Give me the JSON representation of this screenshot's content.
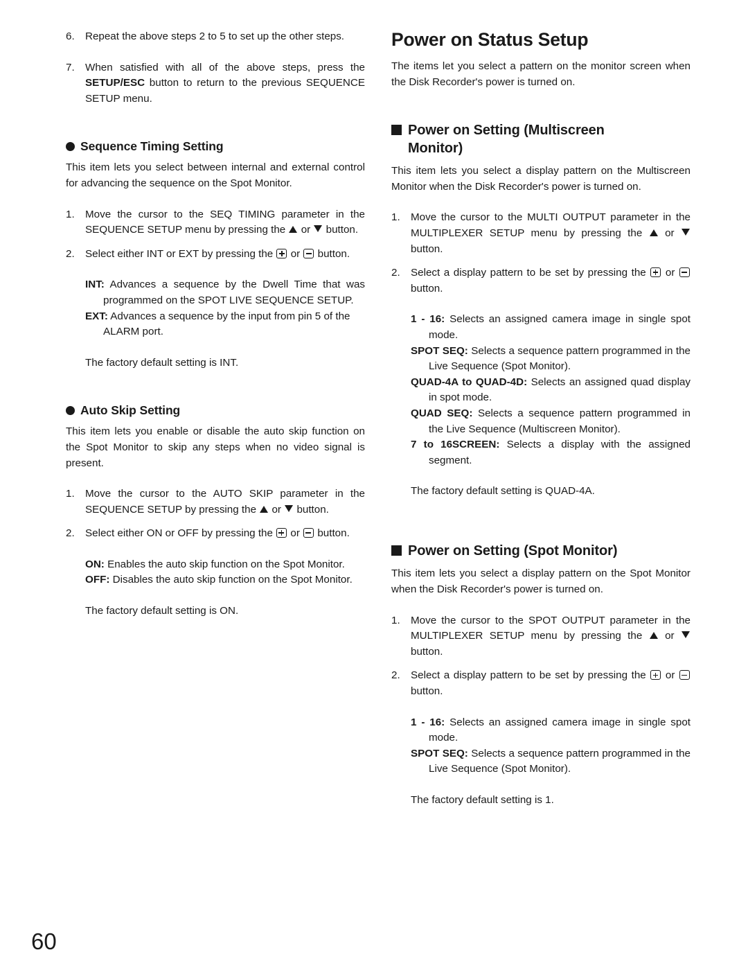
{
  "page": {
    "number": "60"
  },
  "left_column": {
    "step6": {
      "num": "6.",
      "text": "Repeat the above steps 2 to 5 to set up the other steps."
    },
    "step7": {
      "num": "7.",
      "text_before": "When satisfied with all of the above steps, press the ",
      "bold": "SETUP/ESC",
      "text_after": " button to return to the previous SEQUENCE SETUP menu."
    },
    "sequence_timing": {
      "heading": "Sequence Timing Setting",
      "intro": "This item lets you select between internal and external control for advancing the sequence on the Spot Monitor.",
      "step1": {
        "num": "1.",
        "text_a": "Move the cursor to the SEQ TIMING parameter in the SEQUENCE SETUP menu by pressing the ",
        "text_b": " or ",
        "text_c": " button."
      },
      "step2": {
        "num": "2.",
        "text_a": "Select either INT or EXT by pressing the ",
        "text_b": " or ",
        "text_c": " button."
      },
      "definitions": [
        {
          "term": "INT:",
          "text": " Advances a sequence by the Dwell Time that was programmed on the SPOT LIVE SEQUENCE SETUP."
        },
        {
          "term": "EXT:",
          "text": " Advances a sequence by the input from pin 5 of the ALARM port."
        }
      ],
      "default_note": "The factory default setting is INT."
    },
    "auto_skip": {
      "heading": "Auto Skip Setting",
      "intro": "This item lets you enable or disable the auto skip function on the Spot Monitor to skip any steps when no video signal is present.",
      "step1": {
        "num": "1.",
        "text_a": "Move the cursor to the AUTO SKIP parameter in the SEQUENCE SETUP by pressing the ",
        "text_b": " or ",
        "text_c": " button."
      },
      "step2": {
        "num": "2.",
        "text_a": "Select either ON or OFF by pressing the ",
        "text_b": " or ",
        "text_c": " button."
      },
      "definitions": [
        {
          "term": "ON:",
          "text": " Enables the auto skip function on the Spot Monitor."
        },
        {
          "term": "OFF:",
          "text": " Disables the auto skip function on the Spot Monitor."
        }
      ],
      "default_note": "The factory default setting is ON."
    }
  },
  "right_column": {
    "main_title": "Power on Status Setup",
    "main_intro": "The items let you select a pattern on the monitor screen when the Disk Recorder's power is turned on.",
    "multiscreen": {
      "heading_line1": "Power on Setting (Multiscreen",
      "heading_line2": "Monitor)",
      "intro": "This item lets you select a display pattern on the Multiscreen Monitor when the Disk Recorder's power is turned on.",
      "step1": {
        "num": "1.",
        "text_a": "Move the cursor to the MULTI OUTPUT parameter in the MULTIPLEXER SETUP menu by pressing the ",
        "text_b": " or ",
        "text_c": " button."
      },
      "step2": {
        "num": "2.",
        "text_a": "Select a display pattern to be set by pressing the ",
        "text_b": " or ",
        "text_c": " button."
      },
      "definitions": [
        {
          "term": "1 - 16:",
          "text": " Selects an assigned camera image in single spot mode."
        },
        {
          "term": "SPOT SEQ:",
          "text": " Selects a sequence pattern programmed in the Live Sequence (Spot Monitor)."
        },
        {
          "term": "QUAD-4A to QUAD-4D:",
          "text": " Selects an assigned quad display in spot mode."
        },
        {
          "term": "QUAD SEQ:",
          "text": " Selects a sequence pattern programmed in the Live Sequence (Multiscreen Monitor)."
        },
        {
          "term": "7 to 16SCREEN:",
          "text": " Selects a display with the assigned segment."
        }
      ],
      "default_note": "The factory default setting is QUAD-4A."
    },
    "spot": {
      "heading": "Power on Setting (Spot Monitor)",
      "intro": "This item lets you select a display pattern on the Spot Monitor when the Disk Recorder's power is turned on.",
      "step1": {
        "num": "1.",
        "text_a": "Move the cursor to the SPOT OUTPUT parameter in the MULTIPLEXER SETUP menu by pressing the ",
        "text_b": " or ",
        "text_c": " button."
      },
      "step2": {
        "num": "2.",
        "text_a": "Select a display pattern to be set by pressing the ",
        "text_b": " or ",
        "text_c": " button."
      },
      "definitions": [
        {
          "term": "1 - 16:",
          "text": " Selects an assigned camera image in single spot mode."
        },
        {
          "term": "SPOT SEQ:",
          "text": " Selects a sequence pattern programmed in the Live Sequence (Spot Monitor)."
        }
      ],
      "default_note": "The factory default setting is 1."
    }
  },
  "icons": {
    "plus_key": "plus-key-icon",
    "minus_key": "minus-key-icon",
    "up_triangle": "triangle-up-icon",
    "down_triangle": "triangle-down-icon",
    "circle_bullet": "circle-bullet-icon",
    "square_bullet": "square-bullet-icon"
  }
}
